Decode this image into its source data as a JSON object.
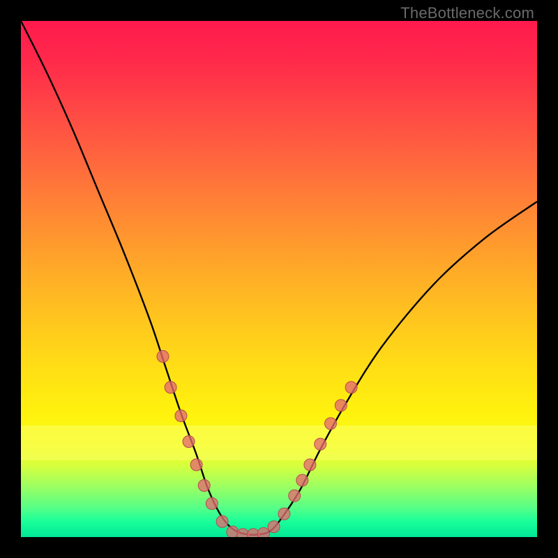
{
  "watermark": "TheBottleneck.com",
  "colors": {
    "frame": "#000000",
    "curve_stroke": "#000000",
    "marker_fill": "#e46a6f",
    "marker_stroke": "#b44a50",
    "gradient_top": "#ff1a4d",
    "gradient_bottom": "#00e696",
    "band": "#fbff66"
  },
  "chart_data": {
    "type": "line",
    "title": "",
    "xlabel": "",
    "ylabel": "",
    "xlim": [
      0,
      100
    ],
    "ylim": [
      0,
      100
    ],
    "grid": false,
    "legend": false,
    "background": "vertical-heat-gradient (red→yellow→green)",
    "series": [
      {
        "name": "bottleneck-curve",
        "x": [
          0,
          5,
          10,
          15,
          20,
          25,
          28,
          31,
          34,
          36,
          38,
          40,
          42,
          44,
          46,
          48,
          50,
          54,
          58,
          63,
          70,
          80,
          90,
          100
        ],
        "y": [
          100,
          90,
          79,
          67,
          55,
          42,
          33,
          24,
          16,
          10,
          5.5,
          2.5,
          1,
          0.5,
          0.5,
          1,
          3,
          9,
          17,
          26,
          37,
          49,
          58,
          65
        ]
      }
    ],
    "markers": [
      {
        "x": 27.5,
        "y": 35
      },
      {
        "x": 29.0,
        "y": 29
      },
      {
        "x": 31.0,
        "y": 23.5
      },
      {
        "x": 32.5,
        "y": 18.5
      },
      {
        "x": 34.0,
        "y": 14
      },
      {
        "x": 35.5,
        "y": 10
      },
      {
        "x": 37.0,
        "y": 6.5
      },
      {
        "x": 39.0,
        "y": 3
      },
      {
        "x": 41.0,
        "y": 1
      },
      {
        "x": 43.0,
        "y": 0.5
      },
      {
        "x": 45.0,
        "y": 0.5
      },
      {
        "x": 47.0,
        "y": 0.7
      },
      {
        "x": 49.0,
        "y": 2
      },
      {
        "x": 51.0,
        "y": 4.5
      },
      {
        "x": 53.0,
        "y": 8
      },
      {
        "x": 54.5,
        "y": 11
      },
      {
        "x": 56.0,
        "y": 14
      },
      {
        "x": 58.0,
        "y": 18
      },
      {
        "x": 60.0,
        "y": 22
      },
      {
        "x": 62.0,
        "y": 25.5
      },
      {
        "x": 64.0,
        "y": 29
      }
    ],
    "band": {
      "y_from": 17,
      "y_to": 24,
      "note": "pale yellow emphasis band"
    }
  }
}
